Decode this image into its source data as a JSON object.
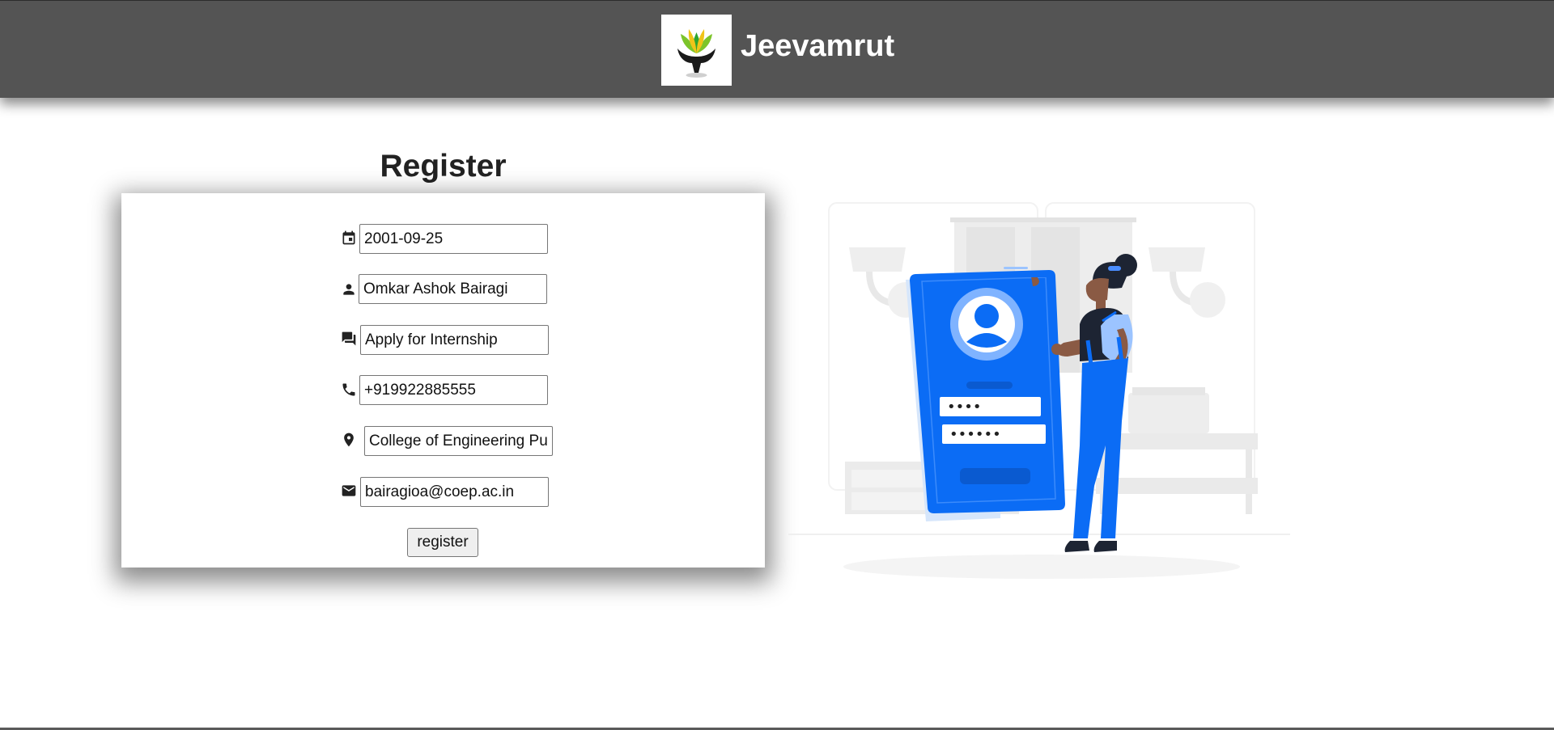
{
  "header": {
    "brand": "Jeevamrut",
    "logo_icon": "lotus-hands-logo"
  },
  "form": {
    "title": "Register",
    "fields": [
      {
        "icon": "calendar-icon",
        "value": "2001-09-25"
      },
      {
        "icon": "person-icon",
        "value": "Omkar Ashok Bairagi"
      },
      {
        "icon": "chat-icon",
        "value": "Apply for Internship"
      },
      {
        "icon": "phone-icon",
        "value": "+919922885555"
      },
      {
        "icon": "location-pin-icon",
        "value": "College of Engineering Pune"
      },
      {
        "icon": "envelope-icon",
        "value": "bairagioa@coep.ac.in"
      }
    ],
    "submit_label": "register"
  },
  "illustration": {
    "password_mask_1": "••••",
    "password_mask_2": "••••••"
  },
  "colors": {
    "header_bg": "#545454",
    "accent_blue": "#0b6cf5",
    "text_dark": "#222222"
  }
}
